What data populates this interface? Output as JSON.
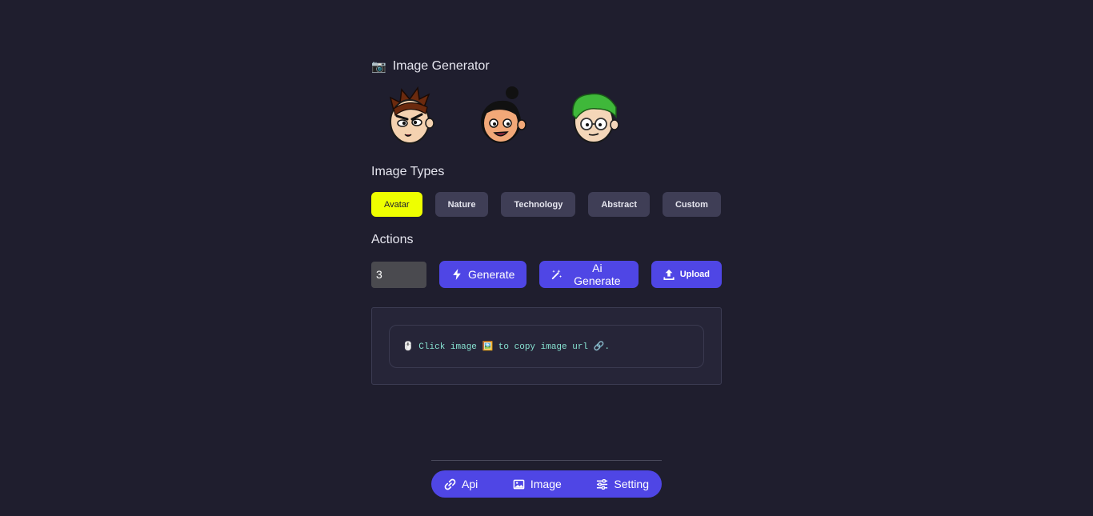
{
  "header": {
    "icon": "camera-icon",
    "title": "Image Generator"
  },
  "avatars": [
    {
      "name": "avatar-brown-hair"
    },
    {
      "name": "avatar-black-bun"
    },
    {
      "name": "avatar-green-hair"
    }
  ],
  "types": {
    "title": "Image Types",
    "items": [
      {
        "label": "Avatar",
        "active": true
      },
      {
        "label": "Nature",
        "active": false
      },
      {
        "label": "Technology",
        "active": false
      },
      {
        "label": "Abstract",
        "active": false
      },
      {
        "label": "Custom",
        "active": false
      }
    ]
  },
  "actions": {
    "title": "Actions",
    "count_value": "3",
    "generate_label": "Generate",
    "ai_generate_label": "Ai Generate",
    "upload_label": "Upload"
  },
  "hint": {
    "text": "🖱️ Click image 🖼️ to copy image url 🔗."
  },
  "bottom_nav": {
    "items": [
      {
        "label": "Api",
        "icon": "link-icon"
      },
      {
        "label": "Image",
        "icon": "image-icon"
      },
      {
        "label": "Setting",
        "icon": "sliders-icon"
      }
    ]
  },
  "colors": {
    "background": "#1f1e2e",
    "accent": "#4f46e5",
    "active_chip": "#eeff00",
    "chip": "#3f3e56",
    "hint_text": "#86e1d0"
  }
}
